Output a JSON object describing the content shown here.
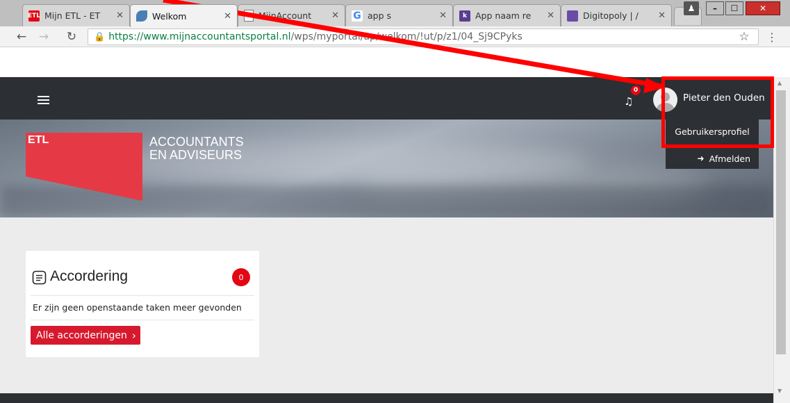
{
  "browser": {
    "tabs": [
      {
        "title": "Mijn ETL - ET",
        "favicon": "etl-logo",
        "fav_text": "ETL",
        "color": "#e30613"
      },
      {
        "title": "Welkom",
        "favicon": "portal-icon",
        "color": "#4a7fb5"
      },
      {
        "title": "MijnAccount",
        "favicon": "document-icon",
        "color": "#777777"
      },
      {
        "title": "app s",
        "favicon": "google-icon",
        "fav_text": "G",
        "color": "#4285f4"
      },
      {
        "title": "App naam re",
        "favicon": "k-icon",
        "fav_text": "k",
        "color": "#5c3c92"
      },
      {
        "title": "Digitopoly | /",
        "favicon": "site-icon",
        "color": "#6a4ca6"
      }
    ],
    "url": {
      "secure_host": "https://www.mijnaccountantsportal.nl",
      "path": "/wps/myportal/ap/welkom/!ut/p/z1/04_Sj9CPyks"
    }
  },
  "header": {
    "notification_count": "0",
    "user_name": "Pieter den Ouden",
    "menu": {
      "profile": "Gebruikersprofiel",
      "logout": "Afmelden"
    }
  },
  "brand": {
    "logo_text": "ETL",
    "tagline_1": "ACCOUNTANTS",
    "tagline_2": "EN ADVISEURS",
    "color": "#e63946"
  },
  "card": {
    "title": "Accordering",
    "badge": "0",
    "empty_text": "Er zijn geen openstaande taken meer gevonden",
    "button_label": "Alle accorderingen",
    "button_chevron": "›"
  },
  "colors": {
    "accent": "#d7192d",
    "nav_bg": "#2c2f33",
    "annotation": "#ff0000"
  }
}
